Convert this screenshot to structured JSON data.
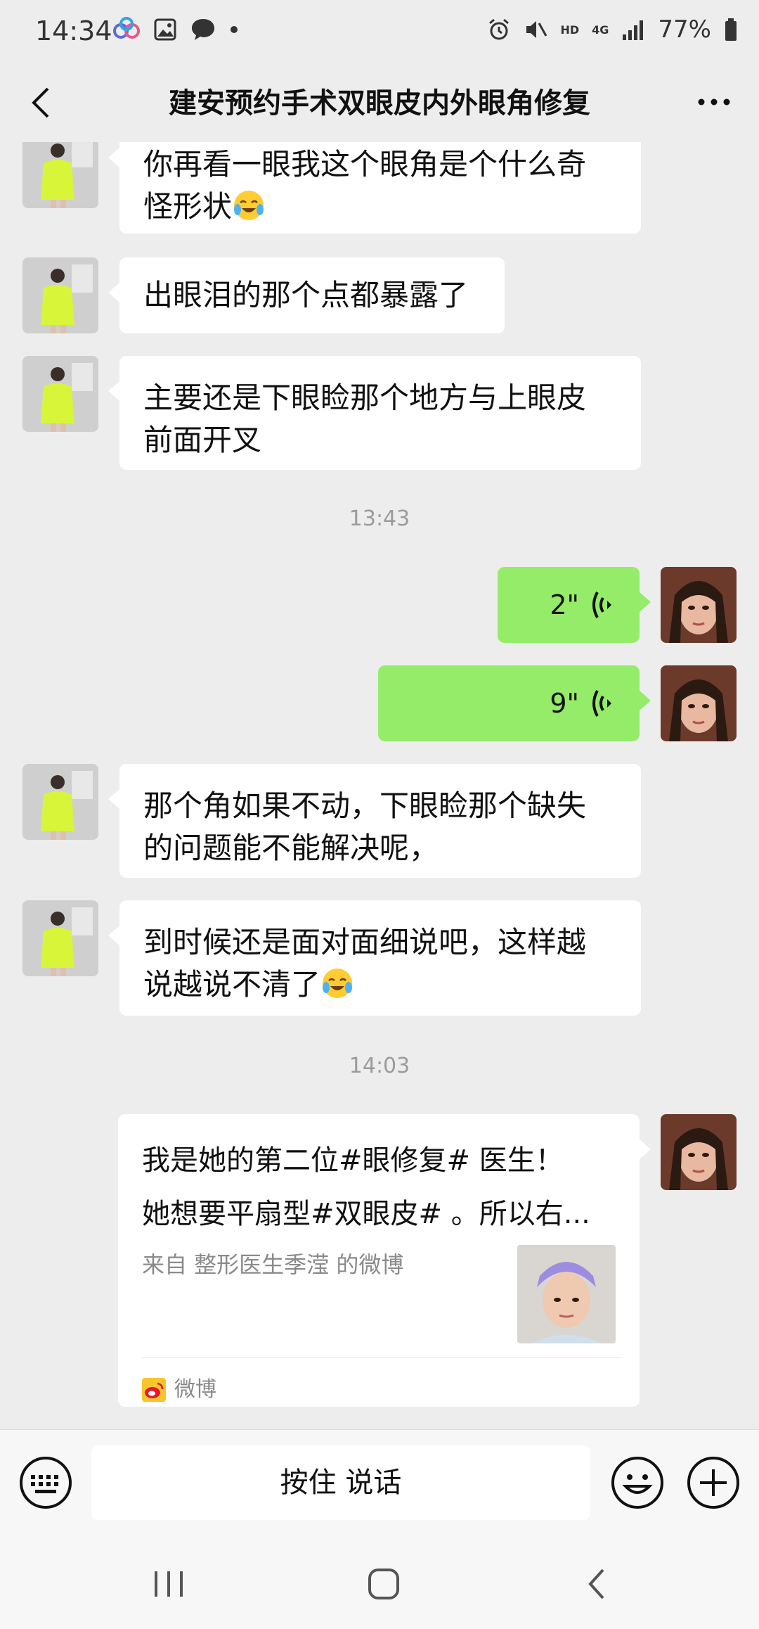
{
  "status_bar": {
    "time": "14:34",
    "hd_label": "HD",
    "network_label": "4G",
    "battery": "77%"
  },
  "header": {
    "title": "建安预约手术双眼皮内外眼角修复"
  },
  "messages": [
    {
      "side": "left",
      "text_line1": "你再看一眼我这个眼角是个什么奇",
      "text_line2": "怪形状"
    },
    {
      "side": "left",
      "text": "出眼泪的那个点都暴露了"
    },
    {
      "side": "left",
      "text_line1": "主要还是下眼睑那个地方与上眼皮",
      "text_line2": "前面开叉"
    },
    {
      "timestamp": "13:43"
    },
    {
      "side": "right",
      "voice_duration": "2\""
    },
    {
      "side": "right",
      "voice_duration": "9\""
    },
    {
      "side": "left",
      "text_line1": "那个角如果不动，下眼睑那个缺失",
      "text_line2": "的问题能不能解决呢，"
    },
    {
      "side": "left",
      "text_line1": "到时候还是面对面细说吧，这样越",
      "text_line2": "说越说不清了"
    },
    {
      "timestamp": "14:03"
    },
    {
      "side": "right",
      "card": {
        "line1": "我是她的第二位#眼修复# 医生！",
        "line2": "她想要平扇型#双眼皮# 。所以右...",
        "source": "来自 整形医生季滢 的微博",
        "app_name": "微博"
      }
    }
  ],
  "input_bar": {
    "hold_to_talk": "按住 说话"
  },
  "colors": {
    "background": "#ededed",
    "sent_bubble": "#95ec69",
    "received_bubble": "#ffffff"
  }
}
